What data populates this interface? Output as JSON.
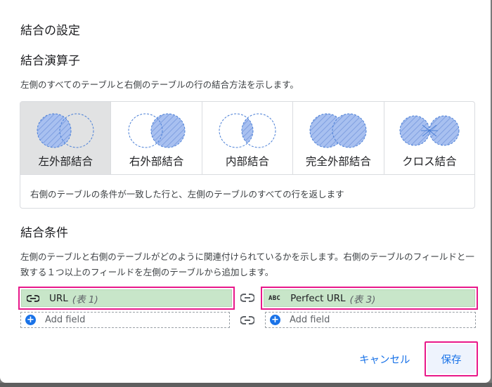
{
  "dialog": {
    "title": "結合の設定",
    "operator_heading": "結合演算子",
    "operator_desc": "左側のすべてのテーブルと右側のテーブルの行の結合方法を示します。",
    "join_types": [
      {
        "label": "左外部結合",
        "icon": "left-join-icon",
        "selected": true
      },
      {
        "label": "右外部結合",
        "icon": "right-join-icon",
        "selected": false
      },
      {
        "label": "内部結合",
        "icon": "inner-join-icon",
        "selected": false
      },
      {
        "label": "完全外部結合",
        "icon": "full-join-icon",
        "selected": false
      },
      {
        "label": "クロス結合",
        "icon": "cross-join-icon",
        "selected": false
      }
    ],
    "join_desc": "右側のテーブルの条件が一致した行と、左側のテーブルのすべての行を返します",
    "conditions_heading": "結合条件",
    "conditions_desc": "左側のテーブルと右側のテーブルがどのように関連付けられているかを示します。右側のテーブルのフィールドと一致する１つ以上のフィールドを左側のテーブルから追加します。",
    "left_field": {
      "name": "URL",
      "table": "(表 1)",
      "icon": "link-icon"
    },
    "right_field": {
      "name": "Perfect URL",
      "table": "(表 3)",
      "icon": "ABC"
    },
    "add_field_label": "Add field",
    "cancel_label": "キャンセル",
    "save_label": "保存"
  },
  "colors": {
    "accent": "#1a73e8",
    "highlight": "#e8188a",
    "field_bg": "#c8e6c9",
    "venn_fill": "#a8c0f0",
    "venn_stroke": "#4a7fd6"
  }
}
